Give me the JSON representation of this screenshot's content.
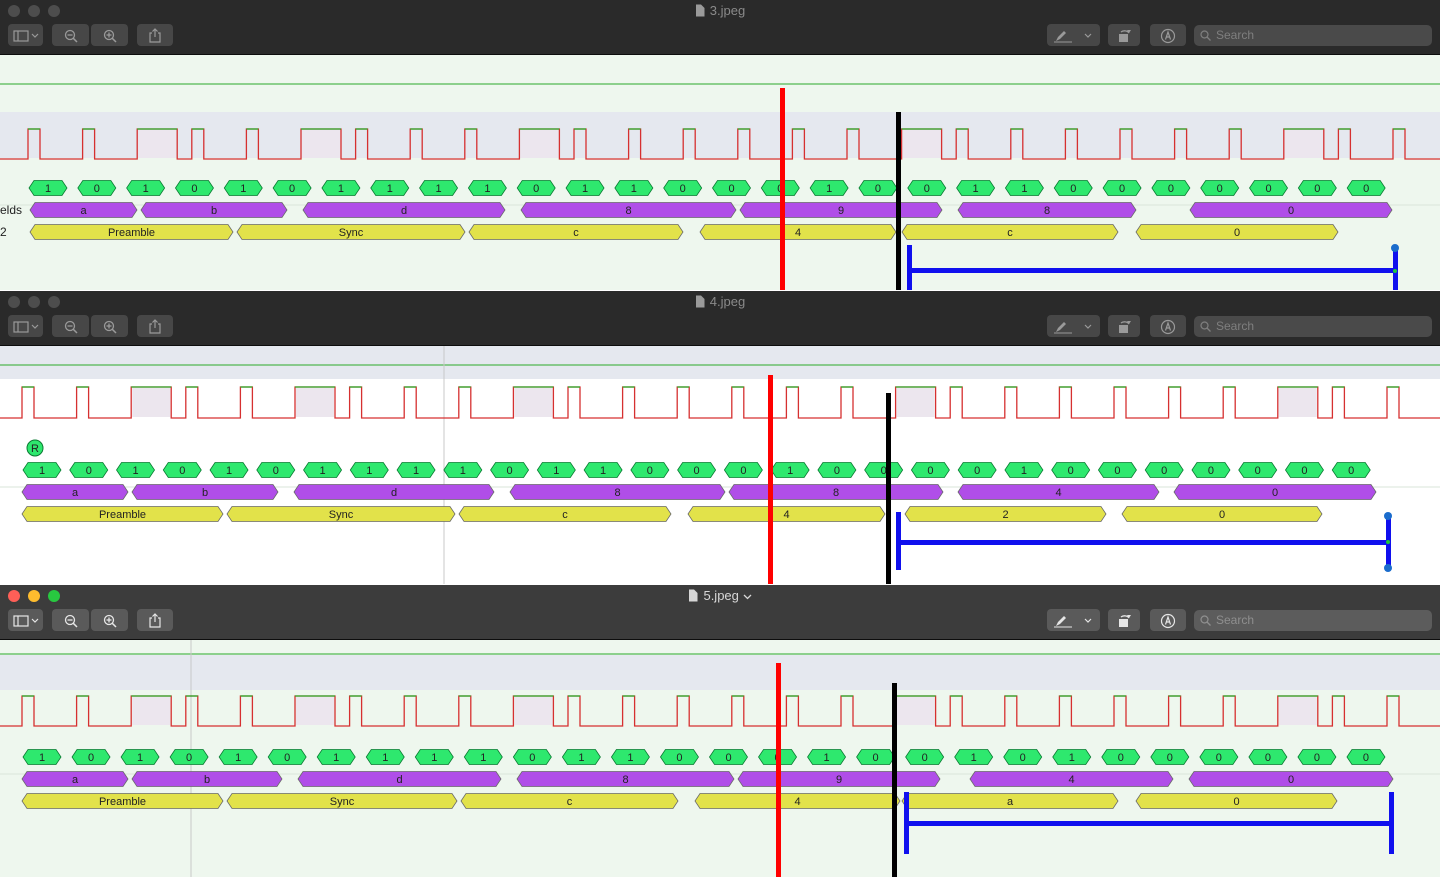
{
  "windows": [
    {
      "title": "3.jpeg",
      "active": false,
      "search_placeholder": "Search",
      "side_label": "elds",
      "side_label2": "2",
      "bits": [
        "1",
        "0",
        "1",
        "0",
        "1",
        "0",
        "1",
        "1",
        "1",
        "1",
        "0",
        "1",
        "1",
        "0",
        "0",
        "0",
        "1",
        "0",
        "0",
        "1",
        "1",
        "0",
        "0",
        "0",
        "0",
        "0",
        "0",
        "0"
      ],
      "fields": [
        "a",
        "b",
        "d",
        "8",
        "9",
        "8",
        "0"
      ],
      "groups": [
        "Preamble",
        "Sync",
        "c",
        "4",
        "c",
        "0"
      ]
    },
    {
      "title": "4.jpeg",
      "active": false,
      "search_placeholder": "Search",
      "marker": "R",
      "bits": [
        "1",
        "0",
        "1",
        "0",
        "1",
        "0",
        "1",
        "1",
        "1",
        "1",
        "0",
        "1",
        "1",
        "0",
        "0",
        "0",
        "1",
        "0",
        "0",
        "0",
        "0",
        "1",
        "0",
        "0",
        "0",
        "0",
        "0",
        "0",
        "0"
      ],
      "fields": [
        "a",
        "b",
        "d",
        "8",
        "8",
        "4",
        "0"
      ],
      "groups": [
        "Preamble",
        "Sync",
        "c",
        "4",
        "2",
        "0"
      ]
    },
    {
      "title": "5.jpeg",
      "active": true,
      "search_placeholder": "Search",
      "bits": [
        "1",
        "0",
        "1",
        "0",
        "1",
        "0",
        "1",
        "1",
        "1",
        "1",
        "0",
        "1",
        "1",
        "0",
        "0",
        "0",
        "1",
        "0",
        "0",
        "1",
        "0",
        "1",
        "0",
        "0",
        "0",
        "0",
        "0",
        "0"
      ],
      "fields": [
        "a",
        "b",
        "d",
        "8",
        "9",
        "4",
        "0"
      ],
      "groups": [
        "Preamble",
        "Sync",
        "c",
        "4",
        "a",
        "0"
      ]
    }
  ],
  "colors": {
    "bit_fill": "#2ee86e",
    "bit_stroke": "#0a7a32",
    "field_fill": "#b04ee8",
    "group_fill": "#e2e24a",
    "trace_low": "#d63030",
    "trace_high": "#2aaa2a",
    "red_marker": "#ff0000",
    "black_marker": "#000000",
    "blue_bracket": "#1010ee"
  },
  "icons": [
    "sidebar-icon",
    "zoom-out-icon",
    "zoom-in-icon",
    "share-icon",
    "markup-pen-icon",
    "rotate-icon",
    "annotate-icon",
    "search-icon",
    "document-icon"
  ]
}
